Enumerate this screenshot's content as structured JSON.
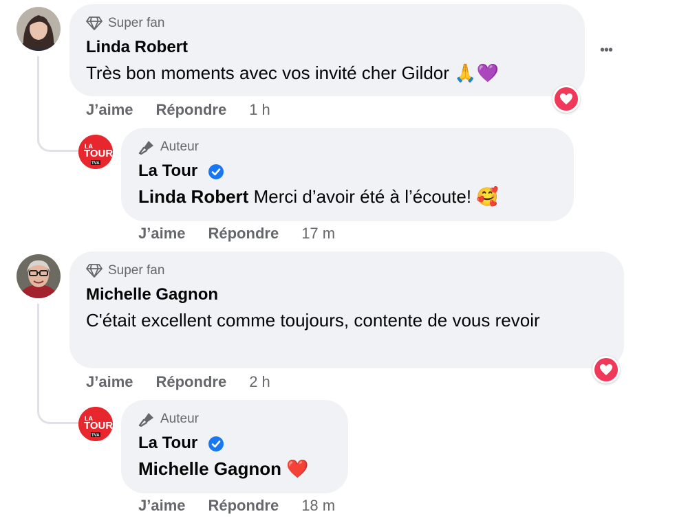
{
  "comments": [
    {
      "badge": "Super fan",
      "author": "Linda Robert",
      "text": "Très bon moments avec vos invité cher Gildor",
      "emoji": "🙏💜",
      "like_label": "J’aime",
      "reply_label": "Répondre",
      "time": "1 h",
      "reaction": "heart",
      "reply": {
        "badge": "Auteur",
        "author": "La Tour",
        "mention": "Linda Robert",
        "text": "Merci d’avoir été à l’écoute!",
        "emoji": "🥰",
        "like_label": "J’aime",
        "reply_label": "Répondre",
        "time": "17 m"
      }
    },
    {
      "badge": "Super fan",
      "author": "Michelle Gagnon",
      "text": "C'était excellent comme toujours, contente de vous revoir",
      "like_label": "J’aime",
      "reply_label": "Répondre",
      "time": "2 h",
      "reaction": "heart",
      "reply": {
        "badge": "Auteur",
        "author": "La Tour",
        "mention": "Michelle Gagnon",
        "emoji": "❤️",
        "like_label": "J’aime",
        "reply_label": "Répondre",
        "time": "18 m"
      }
    }
  ],
  "page_logo": {
    "line1": "LA",
    "line2": "TOUR",
    "line3": "TVA"
  },
  "more_options_glyph": "•••",
  "colors": {
    "bubble": "#f0f2f5",
    "secondary_text": "#65676b",
    "verified": "#1877f2",
    "heart": "#f0385a",
    "logo_red": "#e8262d"
  }
}
